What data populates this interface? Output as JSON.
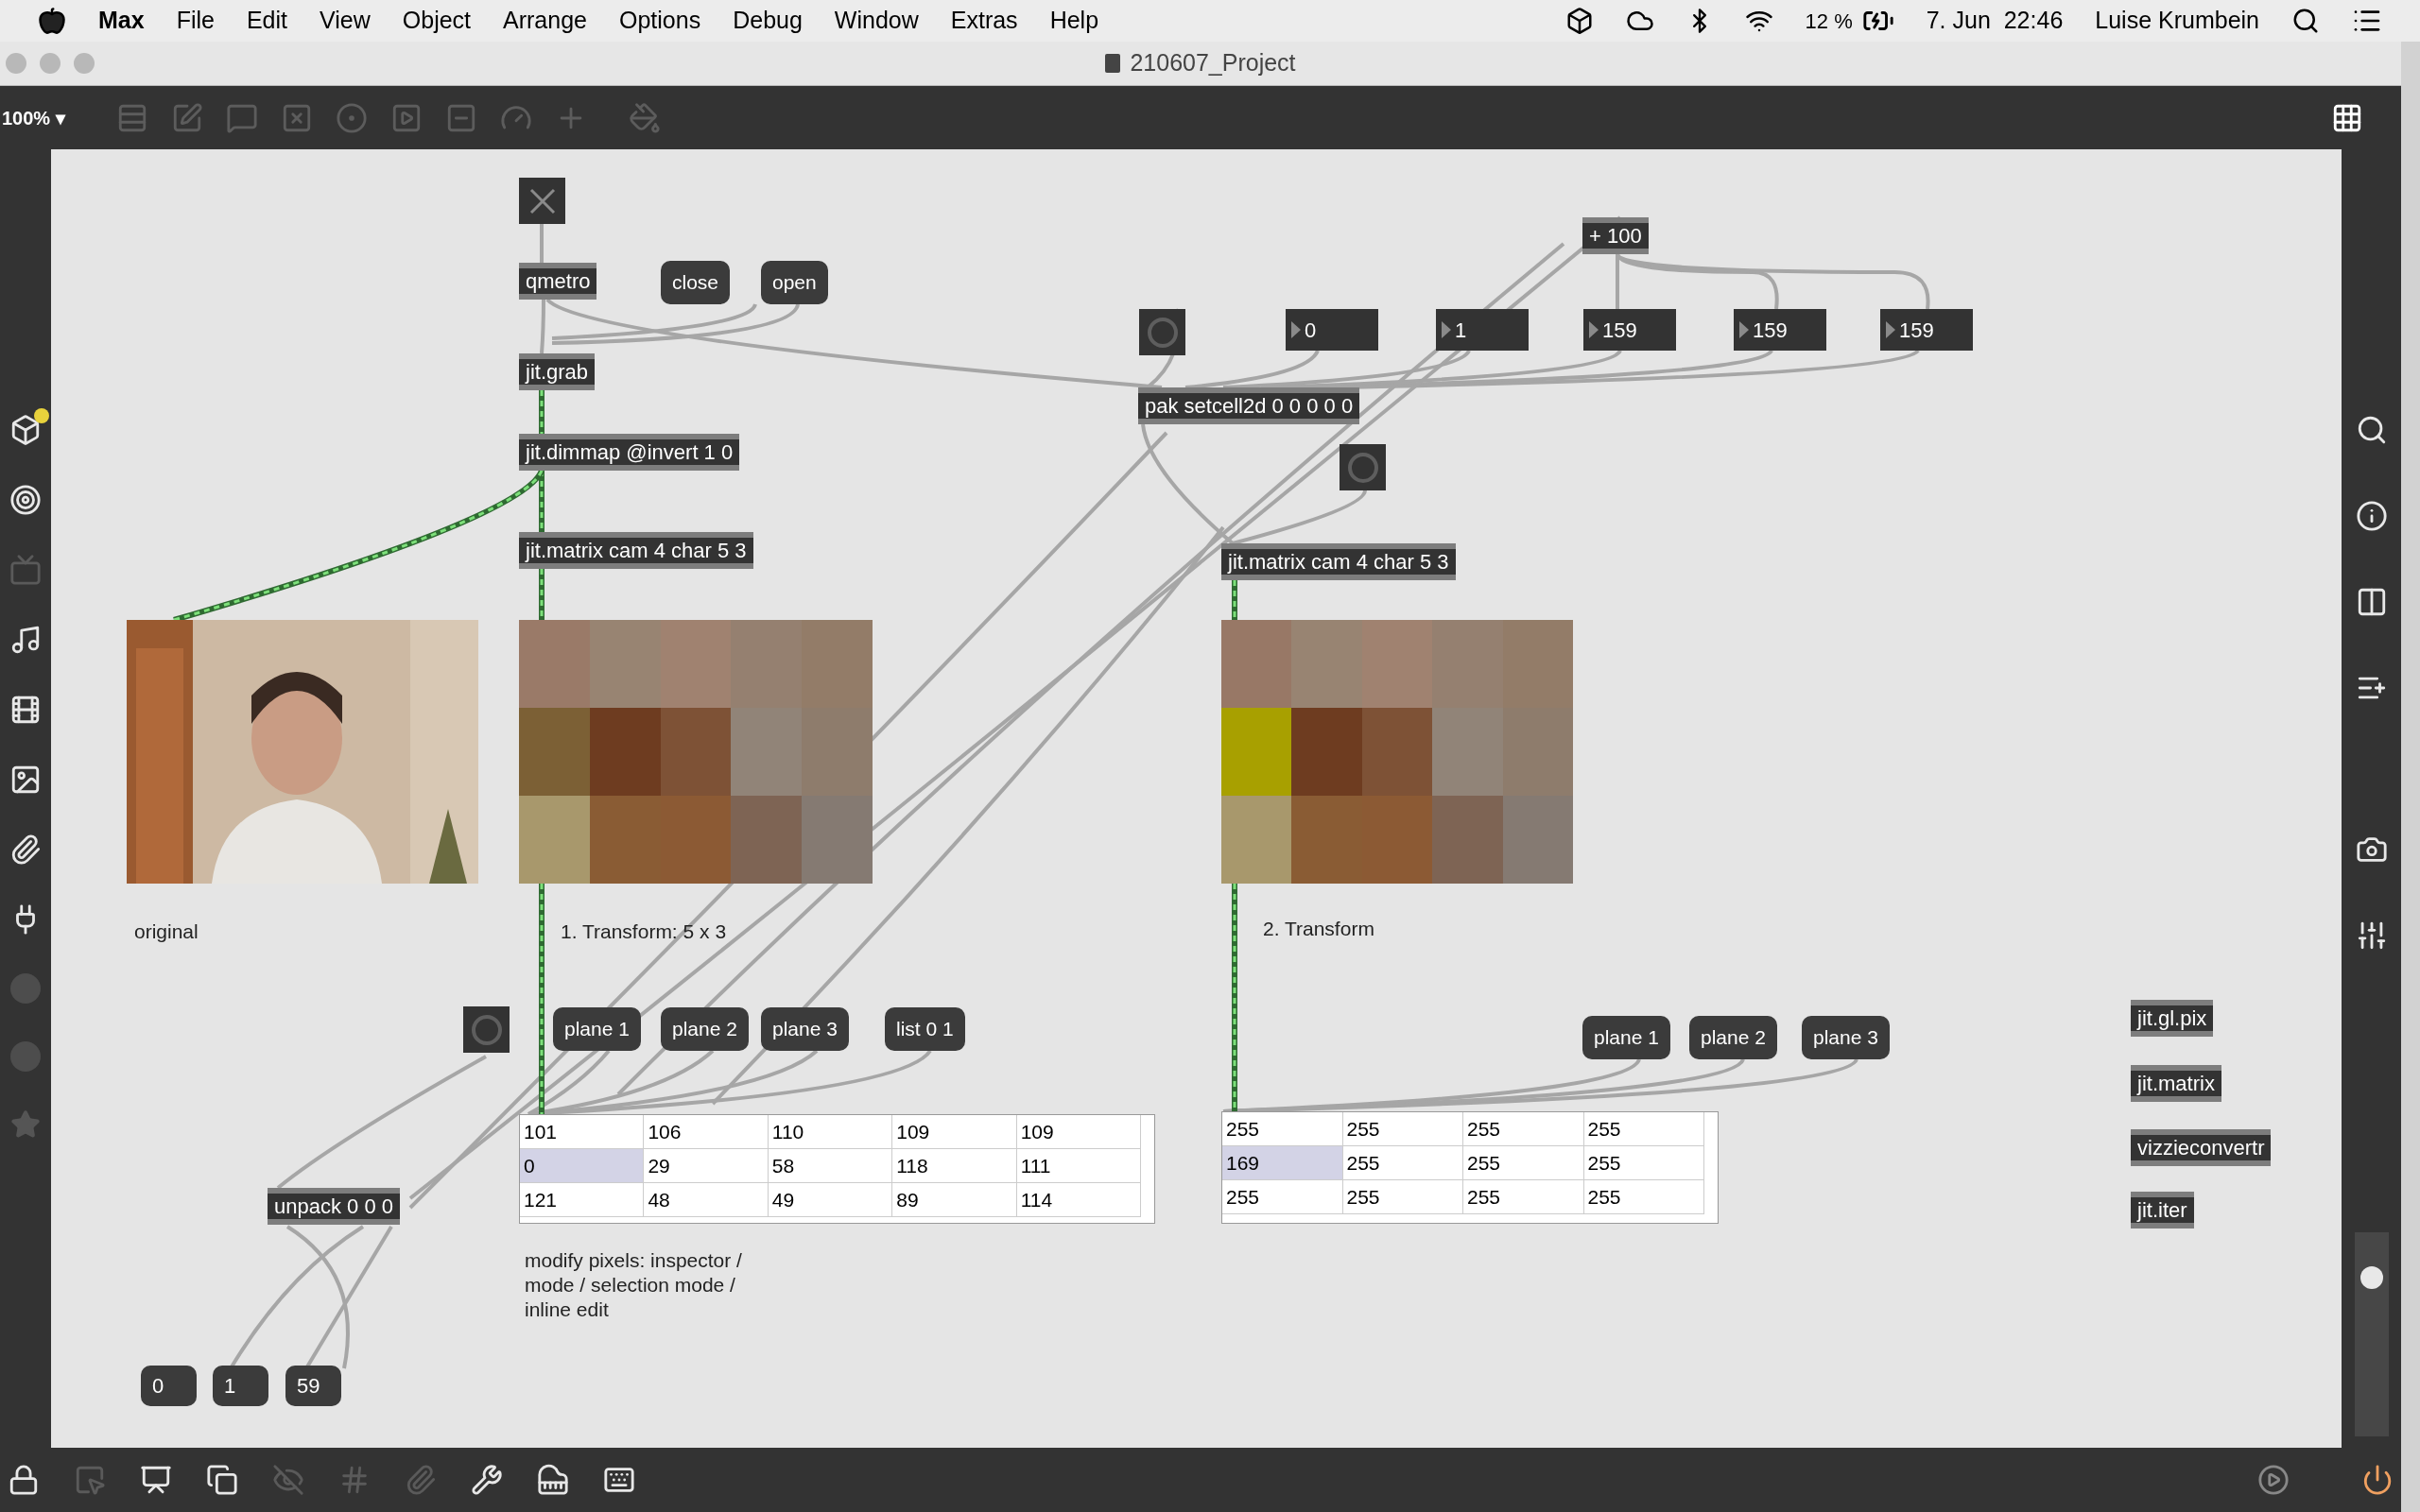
{
  "menu_bar": {
    "app": "Max",
    "items": [
      "File",
      "Edit",
      "View",
      "Object",
      "Arrange",
      "Options",
      "Debug",
      "Window",
      "Extras",
      "Help"
    ],
    "battery": "12 %",
    "date": "7. Jun",
    "time": "22:46",
    "user": "Luise Krumbein"
  },
  "window": {
    "title": "210607_Project"
  },
  "toolbar": {
    "zoom": "100%",
    "zoom_caret": "▾"
  },
  "patch": {
    "objects": [
      {
        "kind": "toggle",
        "checked": true
      },
      {
        "kind": "object",
        "text": "qmetro"
      },
      {
        "kind": "message",
        "text": "close"
      },
      {
        "kind": "message",
        "text": "open"
      },
      {
        "kind": "object",
        "text": "jit.grab"
      },
      {
        "kind": "object",
        "text": "jit.dimmap @invert 1 0"
      },
      {
        "kind": "object",
        "text": "jit.matrix cam 4 char 5 3"
      },
      {
        "kind": "picture"
      },
      {
        "kind": "matrix_display",
        "rows": [
          [
            {
              "color": "#9a7a68"
            },
            {
              "color": "#988472"
            },
            {
              "color": "#a08270"
            },
            {
              "color": "#958070"
            },
            {
              "color": "#937c68"
            }
          ],
          [
            {
              "color": "#7c6035"
            },
            {
              "color": "#6e3c20"
            },
            {
              "color": "#7e5236"
            },
            {
              "color": "#918478"
            },
            {
              "color": "#8e7c6c"
            }
          ],
          [
            {
              "color": "#a8986c"
            },
            {
              "color": "#8a5c34"
            },
            {
              "color": "#8c5a34"
            },
            {
              "color": "#7e6454"
            },
            {
              "color": "#857a72"
            }
          ]
        ]
      },
      {
        "kind": "comment",
        "text": "original"
      },
      {
        "kind": "comment",
        "text": "1. Transform: 5 x 3"
      },
      {
        "kind": "bang"
      },
      {
        "kind": "message",
        "text": "plane 1"
      },
      {
        "kind": "message",
        "text": "plane 2"
      },
      {
        "kind": "message",
        "text": "plane 3"
      },
      {
        "kind": "message",
        "text": "list 0 1"
      },
      {
        "kind": "cellblock",
        "rows": [
          [
            {
              "text": "101",
              "selected": false
            },
            {
              "text": "106",
              "selected": false
            },
            {
              "text": "110",
              "selected": false
            },
            {
              "text": "109",
              "selected": false
            },
            {
              "text": "109",
              "selected": false
            }
          ],
          [
            {
              "text": "0",
              "selected": true
            },
            {
              "text": "29",
              "selected": false
            },
            {
              "text": "58",
              "selected": false
            },
            {
              "text": "118",
              "selected": false
            },
            {
              "text": "111",
              "selected": false
            }
          ],
          [
            {
              "text": "121",
              "selected": false
            },
            {
              "text": "48",
              "selected": false
            },
            {
              "text": "49",
              "selected": false
            },
            {
              "text": "89",
              "selected": false
            },
            {
              "text": "114",
              "selected": false
            }
          ]
        ]
      },
      {
        "kind": "object",
        "text": "unpack 0 0 0"
      },
      {
        "kind": "comment",
        "text": "modify pixels: inspector / mode / selection mode /  inline edit"
      },
      {
        "kind": "number",
        "text": "0"
      },
      {
        "kind": "number",
        "text": "1"
      },
      {
        "kind": "number",
        "text": "59"
      },
      {
        "kind": "bang"
      },
      {
        "kind": "number",
        "text": "0"
      },
      {
        "kind": "number",
        "text": "1"
      },
      {
        "kind": "number",
        "text": "159"
      },
      {
        "kind": "number",
        "text": "159"
      },
      {
        "kind": "number",
        "text": "159"
      },
      {
        "kind": "object",
        "text": "+ 100"
      },
      {
        "kind": "object",
        "text": "pak setcell2d 0 0 0 0 0"
      },
      {
        "kind": "bang"
      },
      {
        "kind": "object",
        "text": "jit.matrix cam 4 char 5 3"
      },
      {
        "kind": "matrix_display",
        "rows": [
          [
            {
              "color": "#987866"
            },
            {
              "color": "#988472"
            },
            {
              "color": "#a08270"
            },
            {
              "color": "#958070"
            },
            {
              "color": "#937c68"
            }
          ],
          [
            {
              "color": "#a8a000"
            },
            {
              "color": "#6e3c20"
            },
            {
              "color": "#7e5236"
            },
            {
              "color": "#918478"
            },
            {
              "color": "#8e7c6c"
            }
          ],
          [
            {
              "color": "#a8986c"
            },
            {
              "color": "#8a5c34"
            },
            {
              "color": "#8c5a34"
            },
            {
              "color": "#7e6454"
            },
            {
              "color": "#857a72"
            }
          ]
        ]
      },
      {
        "kind": "comment",
        "text": "2. Transform"
      },
      {
        "kind": "message",
        "text": "plane 1"
      },
      {
        "kind": "message",
        "text": "plane 2"
      },
      {
        "kind": "message",
        "text": "plane 3"
      },
      {
        "kind": "cellblock",
        "rows": [
          [
            {
              "text": "255",
              "selected": false
            },
            {
              "text": "255",
              "selected": false
            },
            {
              "text": "255",
              "selected": false
            },
            {
              "text": "255",
              "selected": false
            }
          ],
          [
            {
              "text": "169",
              "selected": true
            },
            {
              "text": "255",
              "selected": false
            },
            {
              "text": "255",
              "selected": false
            },
            {
              "text": "255",
              "selected": false
            }
          ],
          [
            {
              "text": "255",
              "selected": false
            },
            {
              "text": "255",
              "selected": false
            },
            {
              "text": "255",
              "selected": false
            },
            {
              "text": "255",
              "selected": false
            }
          ]
        ]
      },
      {
        "kind": "object",
        "text": "jit.gl.pix"
      },
      {
        "kind": "object",
        "text": "jit.matrix"
      },
      {
        "kind": "object",
        "text": "vizzieconvertr"
      },
      {
        "kind": "object",
        "text": "jit.iter"
      }
    ]
  },
  "right_sidebar": {
    "gain_slider": {
      "level": 0.78
    }
  }
}
